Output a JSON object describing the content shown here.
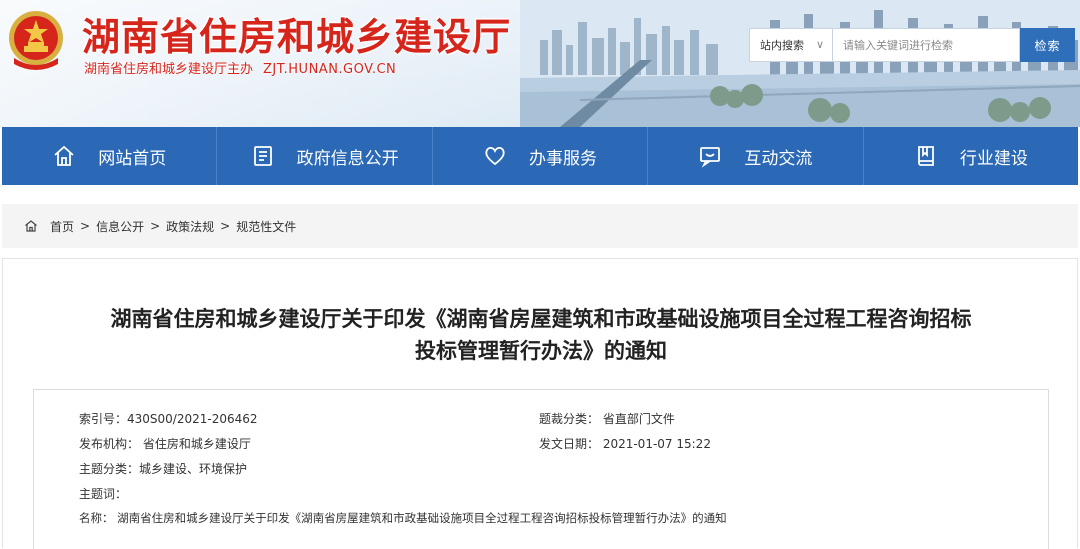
{
  "header": {
    "title": "湖南省住房和城乡建设厅",
    "subtitle": "湖南省住房和城乡建设厅主办",
    "domain": "ZJT.HUNAN.GOV.CN",
    "search": {
      "scope": "站内搜索",
      "scope_caret": "∨",
      "placeholder": "请输入关键词进行检索",
      "button": "检索"
    }
  },
  "nav": [
    {
      "label": "网站首页",
      "icon": "home-icon"
    },
    {
      "label": "政府信息公开",
      "icon": "document-icon"
    },
    {
      "label": "办事服务",
      "icon": "heart-icon"
    },
    {
      "label": "互动交流",
      "icon": "chat-icon"
    },
    {
      "label": "行业建设",
      "icon": "book-icon"
    }
  ],
  "breadcrumb": [
    "首页",
    "信息公开",
    "政策法规",
    "规范性文件"
  ],
  "breadcrumb_sep": ">",
  "article": {
    "title_line1": "湖南省住房和城乡建设厅关于印发《湖南省房屋建筑和市政基础设施项目全过程工程咨询招标",
    "title_line2": "投标管理暂行办法》的通知"
  },
  "meta": {
    "index_no": "索引号：430S00/2021-206462",
    "genre": "题裁分类：  省直部门文件",
    "publisher": "发布机构：  省住房和城乡建设厅",
    "date": "发文日期：  2021-01-07 15:22",
    "topic": "主题分类：城乡建设、环境保护",
    "keywords": "主题词：",
    "name": "名称：  湖南省住房和城乡建设厅关于印发《湖南省房屋建筑和市政基础设施项目全过程工程咨询招标投标管理暂行办法》的通知"
  },
  "colors": {
    "brand_red": "#d6261c",
    "nav_blue": "#2b69b6",
    "button_blue": "#2f6fba"
  }
}
